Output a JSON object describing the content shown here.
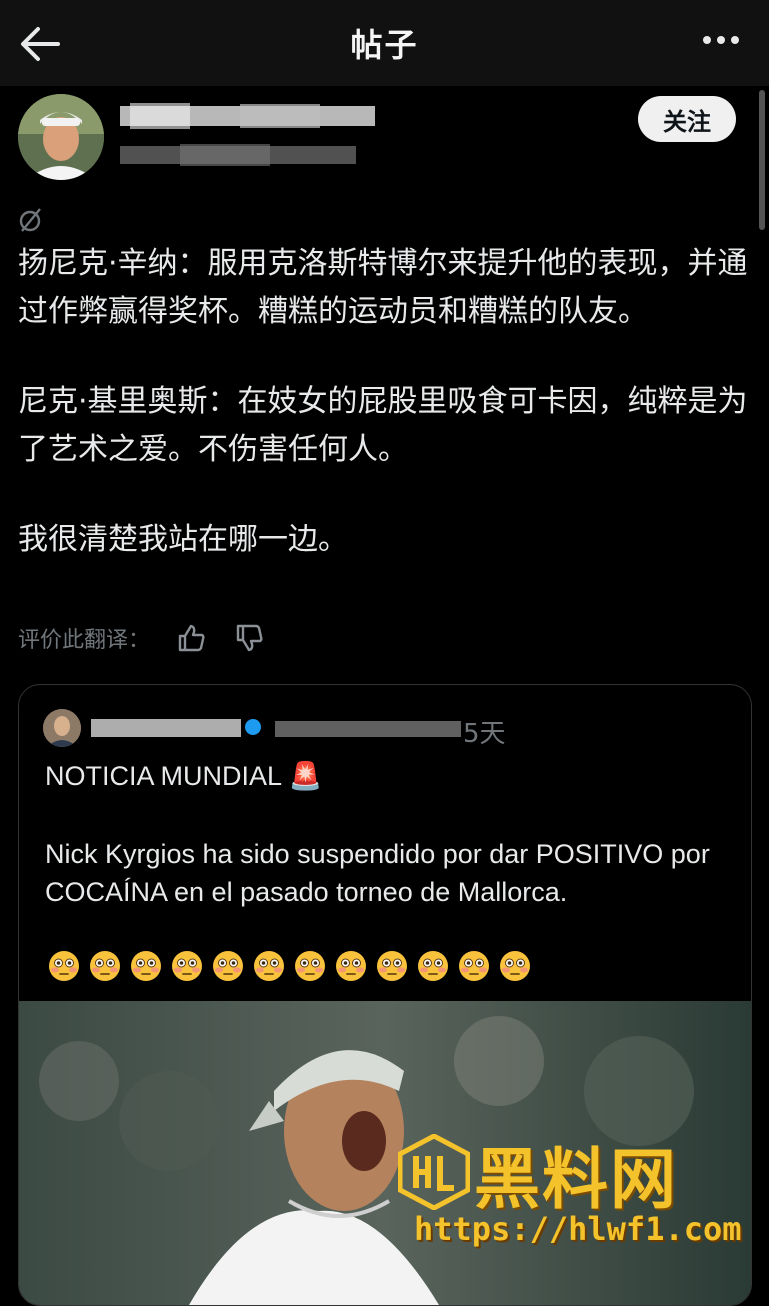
{
  "header": {
    "title": "帖子",
    "back_icon": "arrow-left-icon",
    "more_icon": "ellipsis-icon"
  },
  "author": {
    "follow_label": "关注"
  },
  "post": {
    "translate_icon": "translate-icon",
    "paragraphs": [
      "扬尼克·辛纳：服用克洛斯特博尔来提升他的表现，并通过作弊赢得奖杯。糟糕的运动员和糟糕的队友。",
      "尼克·基里奥斯：在妓女的屁股里吸食可卡因，纯粹是为了艺术之爱。不伤害任何人。",
      "我很清楚我站在哪一边。"
    ],
    "rate_label": "评价此翻译："
  },
  "quote": {
    "time": "5天",
    "line1": "NOTICIA MUNDIAL 🚨",
    "body": "Nick Kyrgios ha sido suspendido por dar POSITIVO por COCAÍNA en el pasado torneo de Mallorca.",
    "emoji_count": 12,
    "emoji_icon": "flushed-face-icon"
  },
  "watermark": {
    "title": "黑料网",
    "url": "https://hlwf1.com"
  },
  "colors": {
    "background": "#000000",
    "text": "#e7e9ea",
    "muted": "#71767b",
    "watermark": "#f4c22b"
  }
}
